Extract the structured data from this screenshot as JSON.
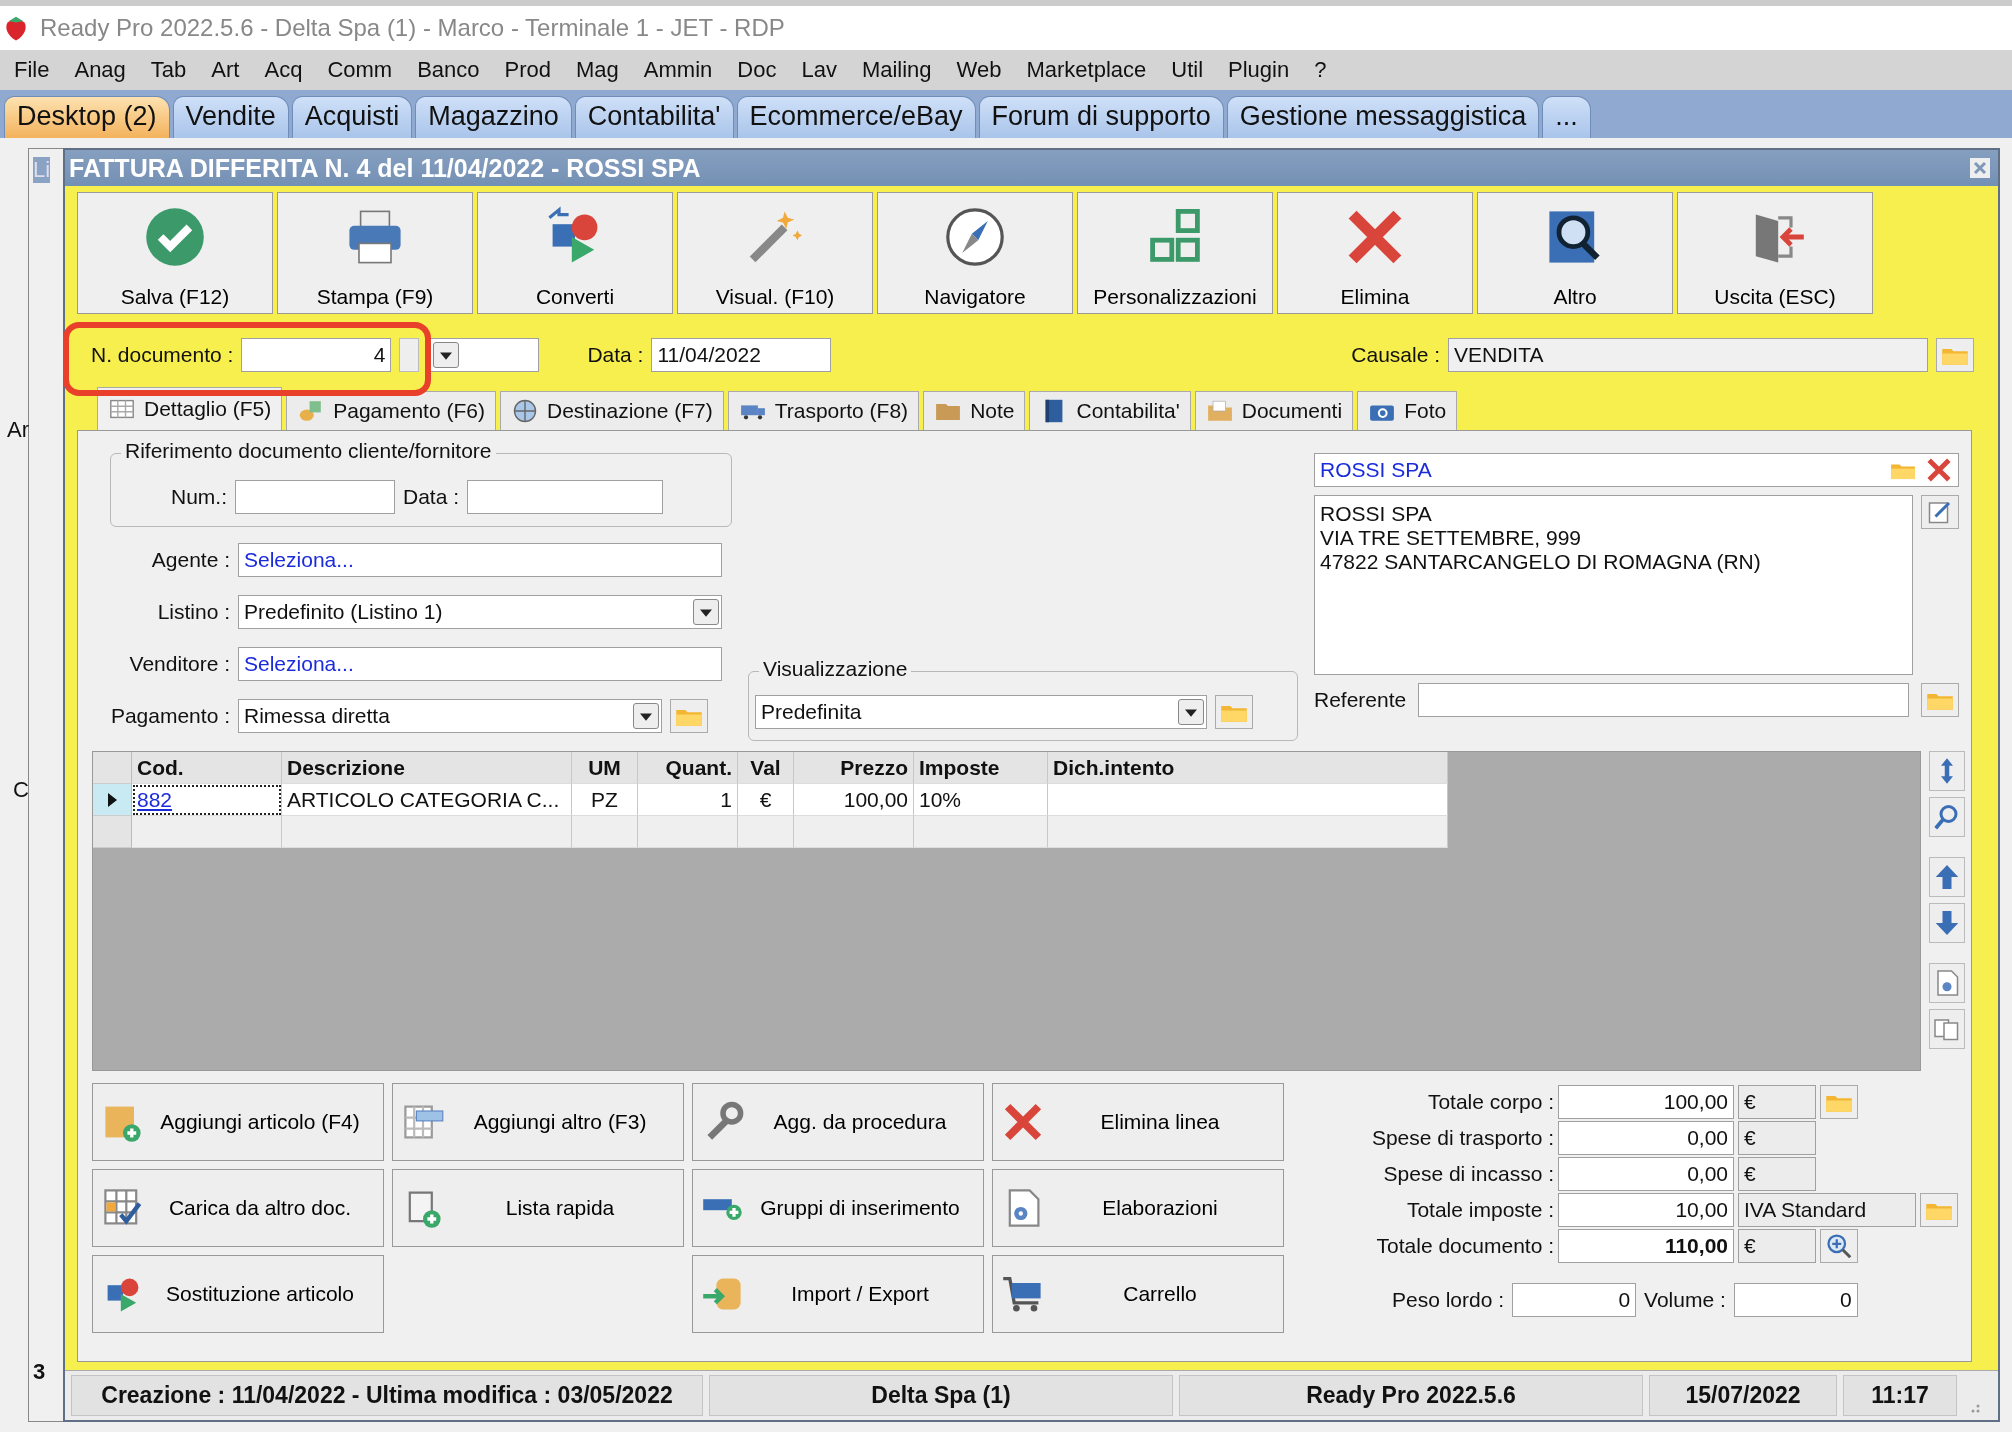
{
  "app_title": "Ready Pro 2022.5.6 - Delta Spa (1) - Marco - Terminale 1 - JET - RDP",
  "menu": [
    "File",
    "Anag",
    "Tab",
    "Art",
    "Acq",
    "Comm",
    "Banco",
    "Prod",
    "Mag",
    "Ammin",
    "Doc",
    "Lav",
    "Mailing",
    "Web",
    "Marketplace",
    "Util",
    "Plugin",
    "?"
  ],
  "tabs": [
    {
      "label": "Desktop (2)",
      "selected": true
    },
    {
      "label": "Vendite",
      "selected": false
    },
    {
      "label": "Acquisti",
      "selected": false
    },
    {
      "label": "Magazzino",
      "selected": false
    },
    {
      "label": "Contabilita'",
      "selected": false
    },
    {
      "label": "Ecommerce/eBay",
      "selected": false
    },
    {
      "label": "Forum di supporto",
      "selected": false
    },
    {
      "label": "Gestione messaggistica",
      "selected": false
    },
    {
      "label": "...",
      "selected": false
    }
  ],
  "back_window": {
    "title": "Li",
    "labels": [
      "Ar",
      "C"
    ],
    "page": "3"
  },
  "document": {
    "title": "FATTURA DIFFERITA N. 4 del 11/04/2022 - ROSSI SPA",
    "toolbar": [
      "Salva (F12)",
      "Stampa (F9)",
      "Converti",
      "Visual. (F10)",
      "Navigatore",
      "Personalizzazioni",
      "Elimina",
      "Altro",
      "Uscita (ESC)"
    ],
    "doc_number": {
      "label": "N. documento :",
      "value": "4"
    },
    "date": {
      "label": "Data :",
      "value": "11/04/2022"
    },
    "causale": {
      "label": "Causale :",
      "value": "VENDITA"
    },
    "tabs": [
      {
        "label": "Dettaglio (F5)",
        "selected": true
      },
      {
        "label": "Pagamento (F6)",
        "selected": false
      },
      {
        "label": "Destinazione (F7)",
        "selected": false
      },
      {
        "label": "Trasporto (F8)",
        "selected": false
      },
      {
        "label": "Note",
        "selected": false
      },
      {
        "label": "Contabilita'",
        "selected": false
      },
      {
        "label": "Documenti",
        "selected": false
      },
      {
        "label": "Foto",
        "selected": false
      }
    ],
    "riferimento": {
      "legend": "Riferimento documento cliente/fornitore",
      "num_label": "Num.:",
      "data_label": "Data :"
    },
    "fields": [
      {
        "label": "Agente :",
        "value": "Seleziona...",
        "kind": "link"
      },
      {
        "label": "Listino :",
        "value": "Predefinito (Listino 1)",
        "kind": "combo"
      },
      {
        "label": "Venditore :",
        "value": "Seleziona...",
        "kind": "link"
      },
      {
        "label": "Pagamento :",
        "value": "Rimessa diretta",
        "kind": "combo_folder"
      }
    ],
    "visualizzazione": {
      "legend": "Visualizzazione",
      "value": "Predefinita"
    },
    "customer": {
      "name": "ROSSI SPA",
      "address": [
        "ROSSI SPA",
        "VIA TRE SETTEMBRE, 999",
        "47822 SANTARCANGELO DI ROMAGNA (RN)"
      ],
      "referente_label": "Referente"
    },
    "table": {
      "columns": [
        "Cod.",
        "Descrizione",
        "UM",
        "Quant.",
        "Val",
        "Prezzo",
        "Imposte",
        "Dich.intento"
      ],
      "rows": [
        {
          "selected": true,
          "cells": [
            "882",
            "ARTICOLO CATEGORIA C...",
            "PZ",
            "1",
            "€",
            "100,00",
            "10%",
            ""
          ]
        }
      ]
    },
    "actions": [
      [
        "Aggiungi articolo (F4)",
        "Carica da altro doc.",
        "Sostituzione articolo"
      ],
      [
        "Aggiungi altro (F3)",
        "Lista rapida"
      ],
      [
        "Agg. da procedura",
        "Gruppi di inserimento",
        "Import / Export"
      ],
      [
        "Elimina linea",
        "Elaborazioni",
        "Carrello"
      ]
    ],
    "totals": [
      {
        "label": "Totale corpo :",
        "value": "100,00",
        "unit": "€",
        "kind": "folder"
      },
      {
        "label": "Spese di trasporto :",
        "value": "0,00",
        "unit": "€",
        "kind": "plain"
      },
      {
        "label": "Spese di incasso :",
        "value": "0,00",
        "unit": "€",
        "kind": "plain"
      },
      {
        "label": "Totale imposte :",
        "value": "10,00",
        "unit": "IVA Standard",
        "kind": "wide_folder"
      },
      {
        "label": "Totale documento :",
        "value": "110,00",
        "unit": "€",
        "kind": "total"
      }
    ],
    "peso": {
      "label": "Peso lordo :",
      "value": "0"
    },
    "volume": {
      "label": "Volume :",
      "value": "0"
    }
  },
  "status": [
    "Creazione : 11/04/2022 - Ultima modifica : 03/05/2022",
    "Delta Spa (1)",
    "Ready Pro 2022.5.6",
    "15/07/2022",
    "11:17"
  ]
}
